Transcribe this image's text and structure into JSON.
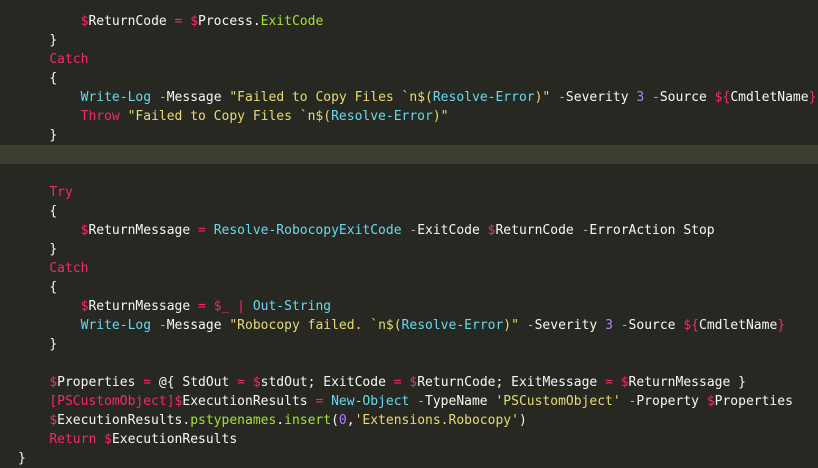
{
  "editor": {
    "theme_colors": {
      "background": "#272822",
      "current_line": "#3e3d32",
      "default_text": "#f8f8f2",
      "keyword": "#f92672",
      "variable": "#f92672",
      "command": "#66d9ef",
      "parameter": "#aaaaaa",
      "string": "#e6db74",
      "number": "#ae81ff",
      "member": "#a6e22e"
    },
    "lines": [
      {
        "indent": "        ",
        "tokens": [
          {
            "t": "$",
            "c": "var"
          },
          {
            "t": "ReturnCode ",
            "c": "plain"
          },
          {
            "t": "= ",
            "c": "op"
          },
          {
            "t": "$",
            "c": "var"
          },
          {
            "t": "Process.",
            "c": "plain"
          },
          {
            "t": "ExitCode",
            "c": "prop"
          }
        ]
      },
      {
        "indent": "    ",
        "tokens": [
          {
            "t": "}",
            "c": "plain"
          }
        ]
      },
      {
        "indent": "    ",
        "tokens": [
          {
            "t": "Catch",
            "c": "kw"
          }
        ]
      },
      {
        "indent": "    ",
        "tokens": [
          {
            "t": "{",
            "c": "plain"
          }
        ]
      },
      {
        "indent": "        ",
        "tokens": [
          {
            "t": "Write-Log ",
            "c": "cmd"
          },
          {
            "t": "-",
            "c": "param"
          },
          {
            "t": "Message ",
            "c": "plain"
          },
          {
            "t": "\"Failed to Copy Files `n$(",
            "c": "str"
          },
          {
            "t": "Resolve-Error",
            "c": "cmd"
          },
          {
            "t": ")\" ",
            "c": "str"
          },
          {
            "t": "-",
            "c": "param"
          },
          {
            "t": "Severity ",
            "c": "plain"
          },
          {
            "t": "3 ",
            "c": "num"
          },
          {
            "t": "-",
            "c": "param"
          },
          {
            "t": "Source ",
            "c": "plain"
          },
          {
            "t": "${",
            "c": "var"
          },
          {
            "t": "CmdletName",
            "c": "plain"
          },
          {
            "t": "}",
            "c": "var"
          }
        ]
      },
      {
        "indent": "        ",
        "tokens": [
          {
            "t": "Throw ",
            "c": "kw"
          },
          {
            "t": "\"Failed to Copy Files `n$(",
            "c": "str"
          },
          {
            "t": "Resolve-Error",
            "c": "cmd"
          },
          {
            "t": ")\"",
            "c": "str"
          }
        ]
      },
      {
        "indent": "    ",
        "tokens": [
          {
            "t": "}",
            "c": "plain"
          }
        ]
      },
      {
        "indent": "",
        "highlight": true,
        "tokens": []
      },
      {
        "indent": "",
        "tokens": []
      },
      {
        "indent": "    ",
        "tokens": [
          {
            "t": "Try",
            "c": "kw"
          }
        ]
      },
      {
        "indent": "    ",
        "tokens": [
          {
            "t": "{",
            "c": "plain"
          }
        ]
      },
      {
        "indent": "        ",
        "tokens": [
          {
            "t": "$",
            "c": "var"
          },
          {
            "t": "ReturnMessage ",
            "c": "plain"
          },
          {
            "t": "= ",
            "c": "op"
          },
          {
            "t": "Resolve-RobocopyExitCode ",
            "c": "cmd"
          },
          {
            "t": "-",
            "c": "param"
          },
          {
            "t": "ExitCode ",
            "c": "plain"
          },
          {
            "t": "$",
            "c": "var"
          },
          {
            "t": "ReturnCode ",
            "c": "plain"
          },
          {
            "t": "-",
            "c": "param"
          },
          {
            "t": "ErrorAction ",
            "c": "plain"
          },
          {
            "t": "Stop",
            "c": "plain"
          }
        ]
      },
      {
        "indent": "    ",
        "tokens": [
          {
            "t": "}",
            "c": "plain"
          }
        ]
      },
      {
        "indent": "    ",
        "tokens": [
          {
            "t": "Catch",
            "c": "kw"
          }
        ]
      },
      {
        "indent": "    ",
        "tokens": [
          {
            "t": "{",
            "c": "plain"
          }
        ]
      },
      {
        "indent": "        ",
        "tokens": [
          {
            "t": "$",
            "c": "var"
          },
          {
            "t": "ReturnMessage ",
            "c": "plain"
          },
          {
            "t": "= ",
            "c": "op"
          },
          {
            "t": "$_ ",
            "c": "var"
          },
          {
            "t": "| ",
            "c": "op"
          },
          {
            "t": "Out-String",
            "c": "cmd"
          }
        ]
      },
      {
        "indent": "        ",
        "tokens": [
          {
            "t": "Write-Log ",
            "c": "cmd"
          },
          {
            "t": "-",
            "c": "param"
          },
          {
            "t": "Message ",
            "c": "plain"
          },
          {
            "t": "\"Robocopy failed. `n$(",
            "c": "str"
          },
          {
            "t": "Resolve-Error",
            "c": "cmd"
          },
          {
            "t": ")\" ",
            "c": "str"
          },
          {
            "t": "-",
            "c": "param"
          },
          {
            "t": "Severity ",
            "c": "plain"
          },
          {
            "t": "3 ",
            "c": "num"
          },
          {
            "t": "-",
            "c": "param"
          },
          {
            "t": "Source ",
            "c": "plain"
          },
          {
            "t": "${",
            "c": "var"
          },
          {
            "t": "CmdletName",
            "c": "plain"
          },
          {
            "t": "}",
            "c": "var"
          }
        ]
      },
      {
        "indent": "    ",
        "tokens": [
          {
            "t": "}",
            "c": "plain"
          }
        ]
      },
      {
        "indent": "",
        "tokens": []
      },
      {
        "indent": "    ",
        "tokens": [
          {
            "t": "$",
            "c": "var"
          },
          {
            "t": "Properties ",
            "c": "plain"
          },
          {
            "t": "= ",
            "c": "op"
          },
          {
            "t": "@{ ",
            "c": "plain"
          },
          {
            "t": "StdOut ",
            "c": "plain"
          },
          {
            "t": "= ",
            "c": "op"
          },
          {
            "t": "$",
            "c": "var"
          },
          {
            "t": "stdOut; ",
            "c": "plain"
          },
          {
            "t": "ExitCode ",
            "c": "plain"
          },
          {
            "t": "= ",
            "c": "op"
          },
          {
            "t": "$",
            "c": "var"
          },
          {
            "t": "ReturnCode; ",
            "c": "plain"
          },
          {
            "t": "ExitMessage ",
            "c": "plain"
          },
          {
            "t": "= ",
            "c": "op"
          },
          {
            "t": "$",
            "c": "var"
          },
          {
            "t": "ReturnMessage }",
            "c": "plain"
          }
        ]
      },
      {
        "indent": "    ",
        "tokens": [
          {
            "t": "[PSCustomObject]",
            "c": "kw"
          },
          {
            "t": "$",
            "c": "var"
          },
          {
            "t": "ExecutionResults ",
            "c": "plain"
          },
          {
            "t": "= ",
            "c": "op"
          },
          {
            "t": "New-Object ",
            "c": "cmd"
          },
          {
            "t": "-",
            "c": "param"
          },
          {
            "t": "TypeName ",
            "c": "plain"
          },
          {
            "t": "'PSCustomObject' ",
            "c": "str"
          },
          {
            "t": "-",
            "c": "param"
          },
          {
            "t": "Property ",
            "c": "plain"
          },
          {
            "t": "$",
            "c": "var"
          },
          {
            "t": "Properties",
            "c": "plain"
          }
        ]
      },
      {
        "indent": "    ",
        "tokens": [
          {
            "t": "$",
            "c": "var"
          },
          {
            "t": "ExecutionResults.",
            "c": "plain"
          },
          {
            "t": "pstypenames",
            "c": "prop"
          },
          {
            "t": ".",
            "c": "plain"
          },
          {
            "t": "insert",
            "c": "method"
          },
          {
            "t": "(",
            "c": "plain"
          },
          {
            "t": "0",
            "c": "num"
          },
          {
            "t": ",",
            "c": "plain"
          },
          {
            "t": "'Extensions.Robocopy'",
            "c": "str"
          },
          {
            "t": ")",
            "c": "plain"
          }
        ]
      },
      {
        "indent": "    ",
        "tokens": [
          {
            "t": "Return ",
            "c": "kw"
          },
          {
            "t": "$",
            "c": "var"
          },
          {
            "t": "ExecutionResults",
            "c": "plain"
          }
        ]
      },
      {
        "indent": "",
        "tokens": [
          {
            "t": "}",
            "c": "plain"
          }
        ]
      }
    ]
  }
}
